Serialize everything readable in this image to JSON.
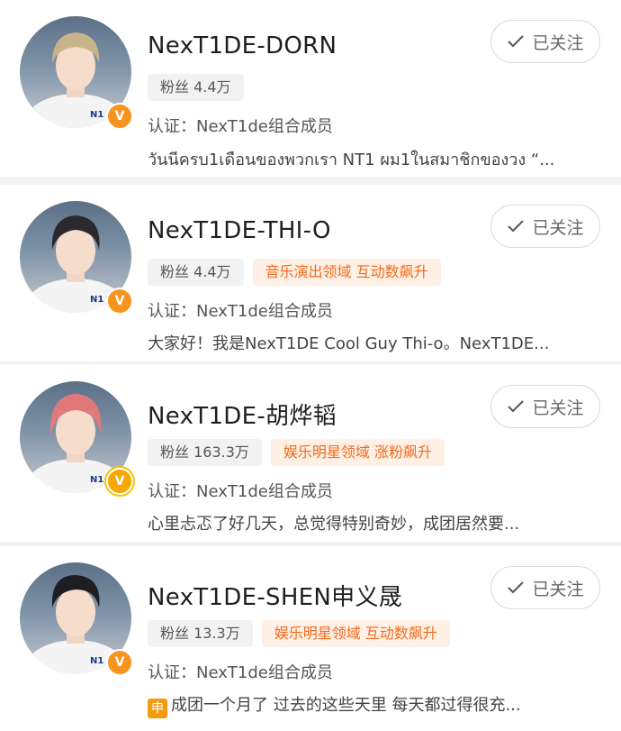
{
  "users": [
    {
      "name": "NexT1DE-DORN",
      "fans": "粉丝 4.4万",
      "tags": [],
      "cert": "认证：NexT1de组合成员",
      "desc": "วันนีครบ1เดือนของพวกเรา NT1 ผม1ในสมาชิกของวง “...",
      "follow": "已关注",
      "hair": "#c8b48a",
      "badge": "v"
    },
    {
      "name": "NexT1DE-THI-O",
      "fans": "粉丝 4.4万",
      "tags": [
        "音乐演出领域 互动数飙升"
      ],
      "cert": "认证：NexT1de组合成员",
      "desc": "大家好！我是NexT1DE Cool Guy Thi-o。NexT1DE...",
      "follow": "已关注",
      "hair": "#2a2a2e",
      "badge": "v"
    },
    {
      "name": "NexT1DE-胡烨韬",
      "fans": "粉丝 163.3万",
      "tags": [
        "娱乐明星领域 涨粉飙升"
      ],
      "cert": "认证：NexT1de组合成员",
      "desc": "心里忐忑了好几天，总觉得特别奇妙，成团居然要...",
      "follow": "已关注",
      "hair": "#e07a7a",
      "badge": "v-gold"
    },
    {
      "name": "NexT1DE-SHEN申义晟",
      "fans": "粉丝 13.3万",
      "tags": [
        "娱乐明星领域 互动数飙升"
      ],
      "cert": "认证：NexT1de组合成员",
      "desc_prefix": "申",
      "desc": "成团一个月了 过去的这些天里 每天都过得很充...",
      "follow": "已关注",
      "hair": "#1e1e22",
      "badge": "v"
    }
  ],
  "colors": {
    "accent": "#f26a1b",
    "badge": "#f7931e"
  },
  "badge_text": "V"
}
